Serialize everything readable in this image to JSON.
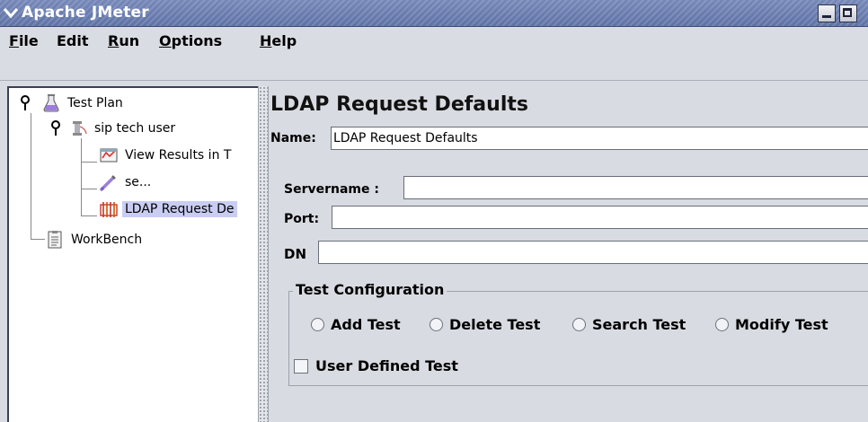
{
  "window": {
    "title": "Apache JMeter",
    "icons": {
      "menu": "chevron-down-icon",
      "minimize": "minimize-icon",
      "maximize": "maximize-icon"
    }
  },
  "menubar": {
    "items": [
      {
        "mnemonic": "F",
        "rest": "ile"
      },
      {
        "mnemonic": "",
        "rest": "Edit"
      },
      {
        "mnemonic": "R",
        "rest": "un"
      },
      {
        "mnemonic": "O",
        "rest": "ptions"
      },
      {
        "mnemonic": "H",
        "rest": "elp"
      }
    ]
  },
  "tree": {
    "nodes": [
      {
        "label": "Test Plan",
        "icon": "flask-icon"
      },
      {
        "label": "sip tech user",
        "icon": "thread-group-icon"
      },
      {
        "label": "View Results in T",
        "icon": "results-icon"
      },
      {
        "label": "se...",
        "icon": "sampler-icon"
      },
      {
        "label": "LDAP Request De",
        "icon": "config-element-icon",
        "selected": true
      },
      {
        "label": "WorkBench",
        "icon": "workbench-icon"
      }
    ]
  },
  "panel": {
    "title": "LDAP Request Defaults",
    "name_label": "Name:",
    "name_value": "LDAP Request Defaults",
    "servername_label": "Servername :",
    "servername_value": "",
    "port_label": "Port:",
    "port_value": "",
    "dn_label": "DN",
    "dn_value": "",
    "test_config": {
      "legend": "Test Configuration",
      "options": [
        "Add Test",
        "Delete Test",
        "Search Test",
        "Modify Test"
      ],
      "user_defined_label": "User Defined Test",
      "user_defined_checked": false
    }
  },
  "colors": {
    "titlebar": "#6a7cb0",
    "selection": "#c9cdf2",
    "panel_bg": "#d8dbe1"
  }
}
